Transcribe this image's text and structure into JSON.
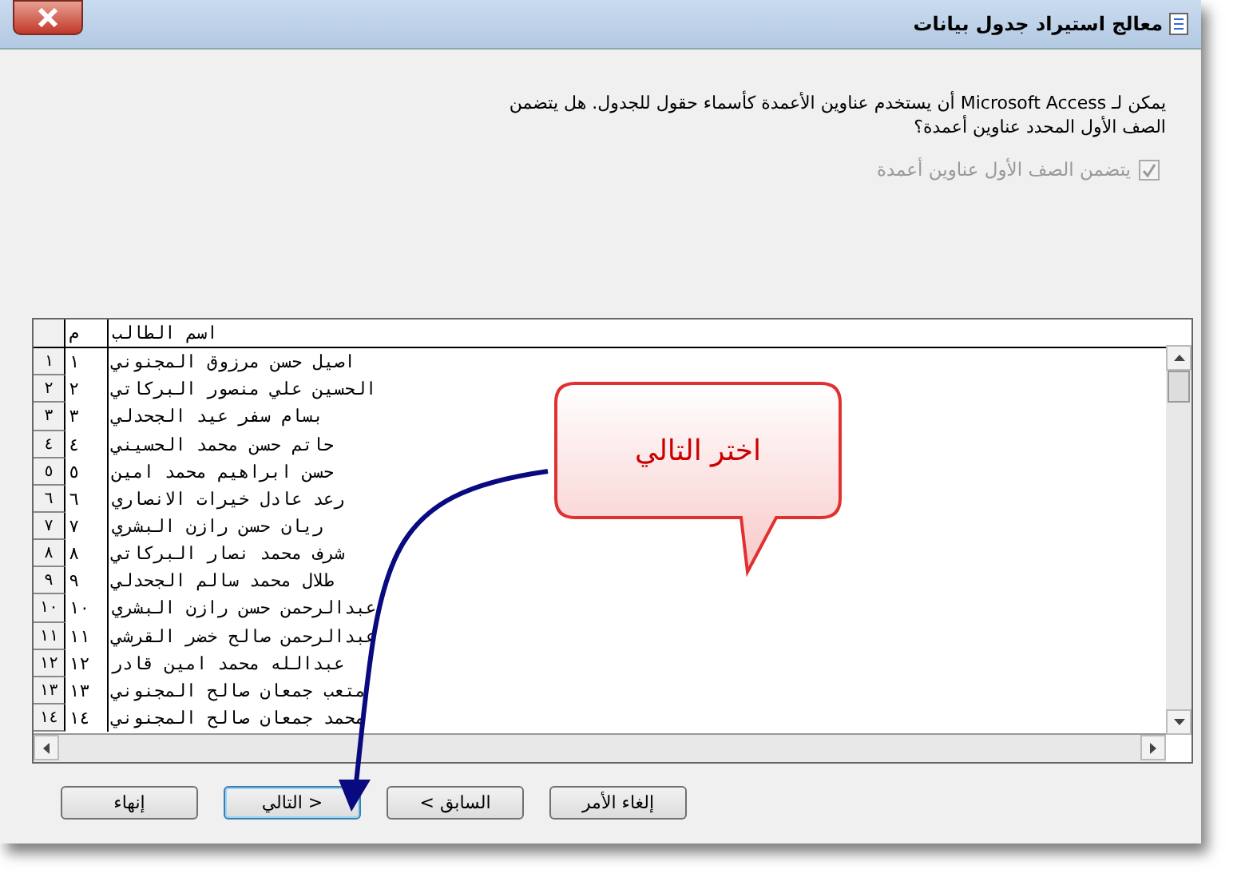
{
  "window": {
    "title": "معالج استيراد جدول بيانات"
  },
  "intro": "يمكن لـ Microsoft Access أن يستخدم عناوين الأعمدة كأسماء حقول للجدول. هل يتضمن الصف الأول المحدد عناوين أعمدة؟",
  "checkbox": {
    "label": "يتضمن الصف الأول عناوين أعمدة",
    "checked": true,
    "disabled": true
  },
  "table": {
    "columns": [
      "اسم الطالب",
      "م"
    ],
    "rows": [
      {
        "selector": "١",
        "num": "١",
        "name": "اصيل حسن مرزوق المجنوني"
      },
      {
        "selector": "٢",
        "num": "٢",
        "name": "الحسين علي منصور البركاتي"
      },
      {
        "selector": "٣",
        "num": "٣",
        "name": "بسام سفر عيد الجحدلي"
      },
      {
        "selector": "٤",
        "num": "٤",
        "name": "حاتم حسن محمد الحسيني"
      },
      {
        "selector": "٥",
        "num": "٥",
        "name": "حسن ابراهيم محمد امين"
      },
      {
        "selector": "٦",
        "num": "٦",
        "name": "رعد عادل خيرات الانصاري"
      },
      {
        "selector": "٧",
        "num": "٧",
        "name": "ريان حسن رازن البشري"
      },
      {
        "selector": "٨",
        "num": "٨",
        "name": "شرف محمد نصار البركاتي"
      },
      {
        "selector": "٩",
        "num": "٩",
        "name": "طلال محمد سالم الجحدلي"
      },
      {
        "selector": "١٠",
        "num": "١٠",
        "name": "عبدالرحمن حسن رازن البشري"
      },
      {
        "selector": "١١",
        "num": "١١",
        "name": "عبدالرحمن صالح خضر القرشي"
      },
      {
        "selector": "١٢",
        "num": "١٢",
        "name": "عبدالله محمد امين قادر"
      },
      {
        "selector": "١٣",
        "num": "١٣",
        "name": "متعب جمعان صالح المجنوني"
      },
      {
        "selector": "١٤",
        "num": "١٤",
        "name": "محمد جمعان صالح المجنوني"
      }
    ]
  },
  "callout": {
    "text": "اختر التالي"
  },
  "buttons": [
    {
      "label": "إلغاء الأمر",
      "focused": false
    },
    {
      "label": "< السابق",
      "focused": false
    },
    {
      "label": "التالي >",
      "focused": true
    },
    {
      "label": "إنهاء",
      "focused": false
    }
  ]
}
